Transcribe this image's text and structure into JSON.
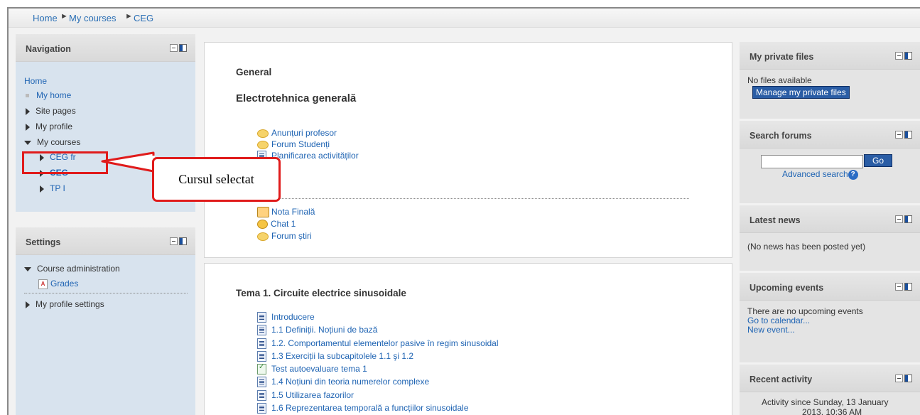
{
  "breadcrumb": {
    "home": "Home",
    "my_courses": "My courses",
    "course": "CEG",
    "separator": "►"
  },
  "navigation": {
    "title": "Navigation",
    "home": "Home",
    "my_home": "My home",
    "site_pages": "Site pages",
    "my_profile": "My profile",
    "my_courses": "My courses",
    "courses": [
      "CEG fr",
      "CEG",
      "TP I"
    ]
  },
  "settings": {
    "title": "Settings",
    "course_admin": "Course administration",
    "grades": "Grades",
    "my_profile_settings": "My profile settings"
  },
  "annotation": {
    "text": "Cursul selectat"
  },
  "section0": {
    "title": "General",
    "subtitle": "Electrotehnica generală",
    "items": [
      "Anunțuri profesor",
      "Forum Studenți",
      "Planificarea activităților"
    ],
    "items2": [
      "Nota Finală",
      "Chat 1",
      "Forum știri"
    ]
  },
  "section1": {
    "title": "Tema 1. Circuite electrice sinusoidale",
    "items": [
      "Introducere",
      "1.1 Definiții. Noțiuni de bază",
      "1.2. Comportamentul elementelor pasive în regim sinusoidal",
      "1.3 Exerciții la subcapitolele 1.1 şi 1.2",
      "Test autoevaluare tema 1",
      "1.4 Noțiuni din teoria numerelor complexe",
      "1.5 Utilizarea fazorilor",
      "1.6 Reprezentarea temporală a funcțiilor sinusoidale"
    ]
  },
  "private_files": {
    "title": "My private files",
    "empty": "No files available",
    "manage": "Manage my private files"
  },
  "search_forums": {
    "title": "Search forums",
    "go": "Go",
    "advanced": "Advanced search",
    "value": ""
  },
  "latest_news": {
    "title": "Latest news",
    "empty": "(No news has been posted yet)"
  },
  "upcoming": {
    "title": "Upcoming events",
    "empty": "There are no upcoming events",
    "calendar": "Go to calendar...",
    "new_event": "New event..."
  },
  "recent": {
    "title": "Recent activity",
    "since": "Activity since Sunday, 13 January",
    "since2": "2013, 10:36 AM"
  },
  "colors": {
    "link": "#1f64b3",
    "callout": "#e01b1b",
    "nav_bg": "#d8e3ee"
  }
}
